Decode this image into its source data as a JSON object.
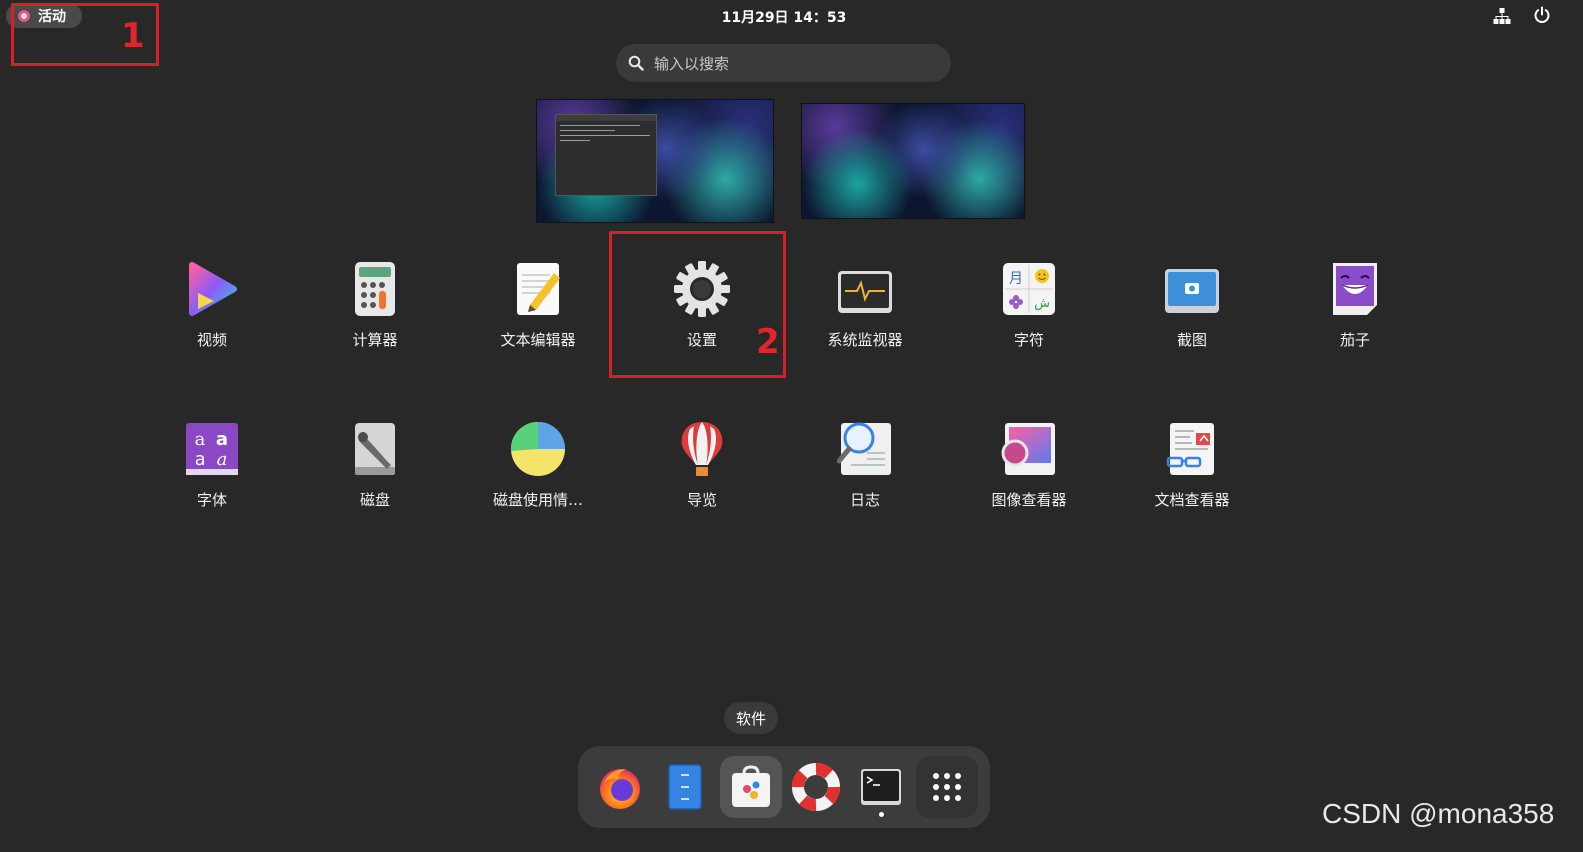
{
  "topbar": {
    "activities_label": "活动",
    "clock": "11月29日  14：53"
  },
  "search": {
    "placeholder": "输入以搜索"
  },
  "annotations": {
    "box1_number": "1",
    "box2_number": "2"
  },
  "apps": [
    {
      "label": "视频",
      "icon": "videos-icon"
    },
    {
      "label": "计算器",
      "icon": "calculator-icon"
    },
    {
      "label": "文本编辑器",
      "icon": "text-editor-icon"
    },
    {
      "label": "设置",
      "icon": "settings-gear-icon"
    },
    {
      "label": "系统监视器",
      "icon": "system-monitor-icon"
    },
    {
      "label": "字符",
      "icon": "characters-icon"
    },
    {
      "label": "截图",
      "icon": "screenshot-icon"
    },
    {
      "label": "茄子",
      "icon": "cheese-icon"
    },
    {
      "label": "字体",
      "icon": "fonts-icon"
    },
    {
      "label": "磁盘",
      "icon": "disks-icon"
    },
    {
      "label": "磁盘使用情…",
      "icon": "disk-usage-icon"
    },
    {
      "label": "导览",
      "icon": "tour-balloon-icon"
    },
    {
      "label": "日志",
      "icon": "logs-icon"
    },
    {
      "label": "图像查看器",
      "icon": "image-viewer-icon"
    },
    {
      "label": "文档查看器",
      "icon": "document-viewer-icon"
    }
  ],
  "dock": {
    "tooltip": "软件",
    "items": [
      "firefox-icon",
      "files-icon",
      "software-icon",
      "help-icon",
      "terminal-icon",
      "app-grid-icon"
    ]
  },
  "watermark": "CSDN @mona358",
  "colors": {
    "background": "#282828",
    "annotation_red": "#d81f26",
    "dock": "#3c3c3c"
  }
}
